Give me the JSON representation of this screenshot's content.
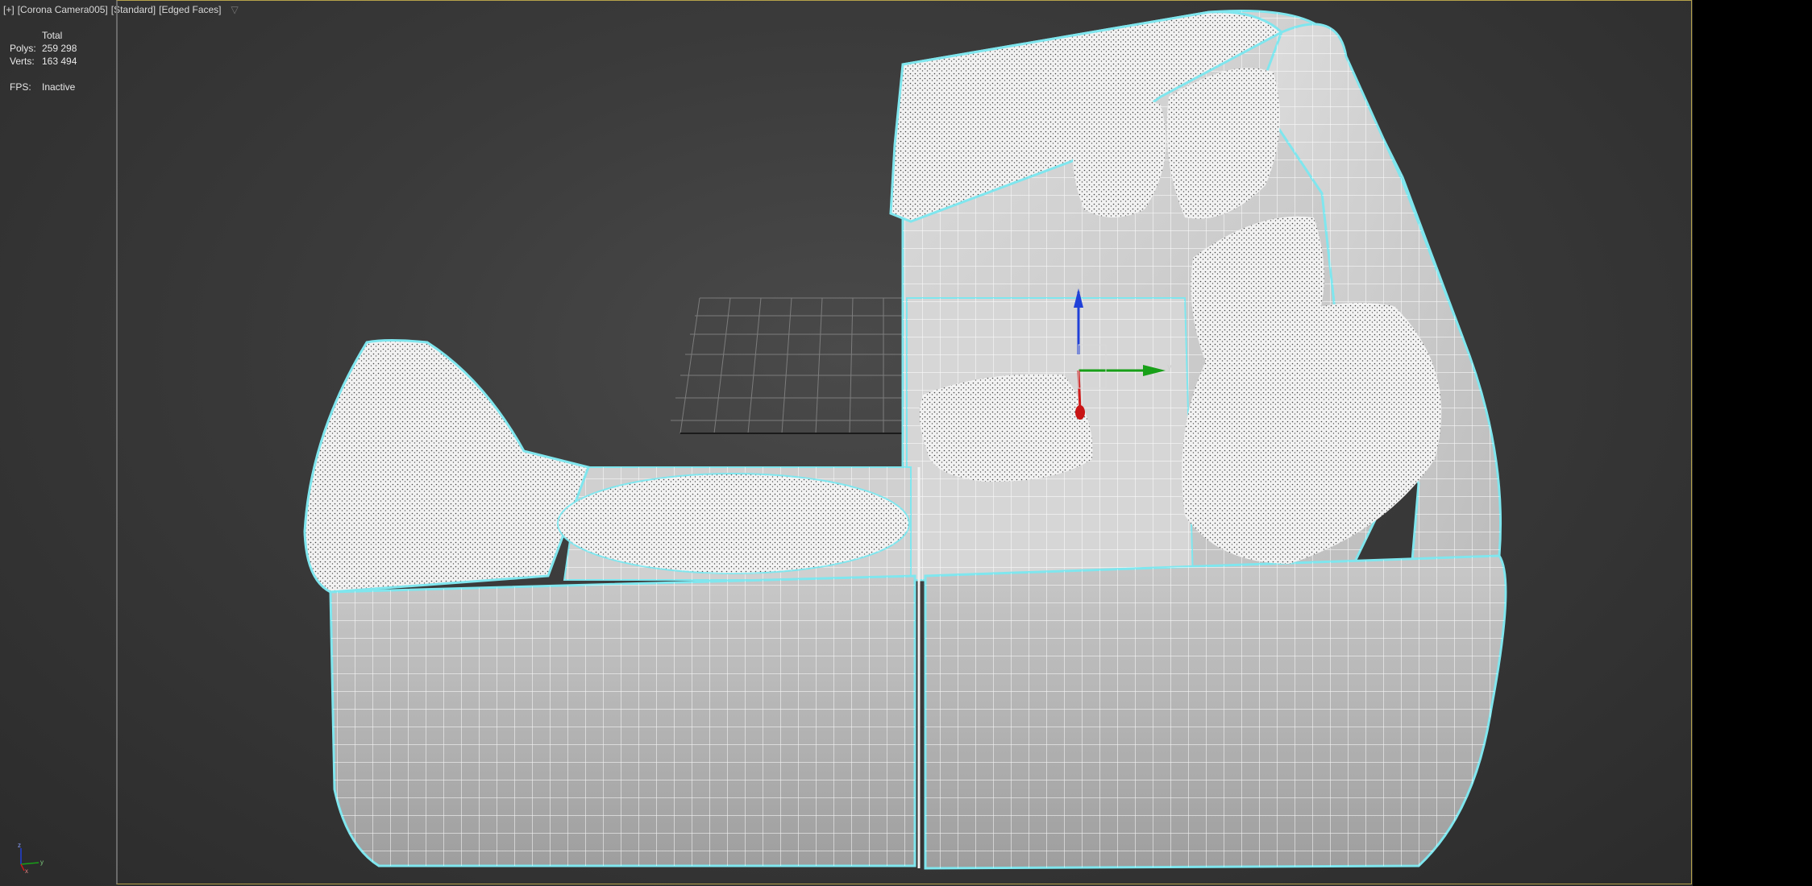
{
  "viewport": {
    "label_parts": [
      "[+]",
      "[Corona Camera005]",
      "[Standard]",
      "[Edged Faces]"
    ],
    "filter_icon": "filter-icon"
  },
  "stats": {
    "header": "Total",
    "polys_label": "Polys:",
    "polys_value": "259 298",
    "verts_label": "Verts:",
    "verts_value": "163 494",
    "fps_label": "FPS:",
    "fps_value": "Inactive"
  },
  "gizmo": {
    "y_label": "y",
    "z_label": "z"
  },
  "tripod": {
    "x_label": "x",
    "y_label": "y",
    "z_label": "z"
  },
  "colors": {
    "selection_outline": "#7fe6ee",
    "mesh_fill": "#bdbdbd",
    "wire": "#ffffff",
    "axis_x": "#d01818",
    "axis_y": "#18a018",
    "axis_z": "#2040d8",
    "viewport_border_active": "#b6a24a"
  }
}
